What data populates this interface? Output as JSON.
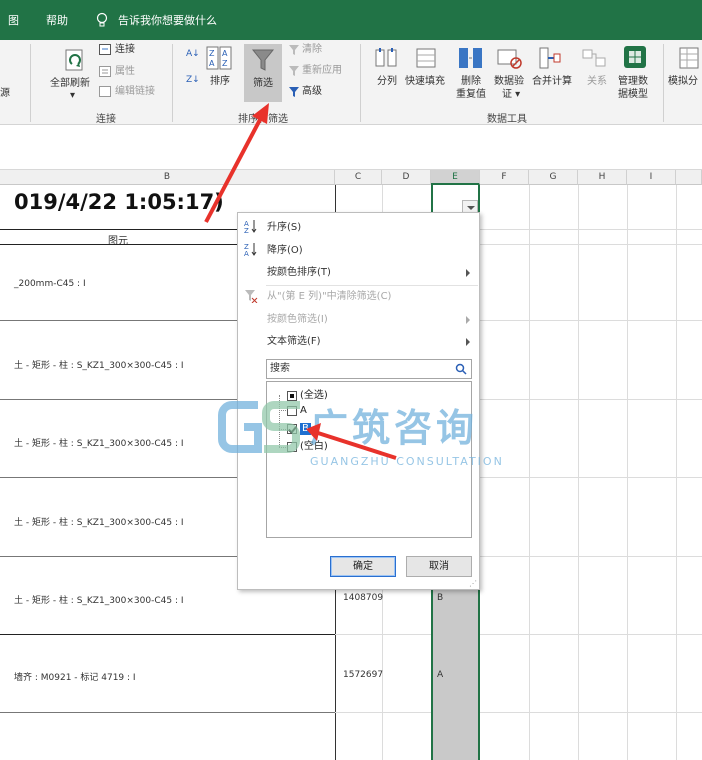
{
  "menubar": {
    "partial_tab": "图",
    "help_tab": "帮助",
    "tell_me": "告诉我你想要做什么",
    "bg_color": "#217346"
  },
  "ribbon": {
    "partial_source": "源",
    "refresh_all": "全部刷新",
    "connections": "连接",
    "properties": "属性",
    "edit_links": "编辑链接",
    "group_connections": "连接",
    "sort": "排序",
    "filter": "筛选",
    "clear": "清除",
    "reapply": "重新应用",
    "advanced": "高级",
    "group_sort_filter": "排序和筛选",
    "text_to_columns": "分列",
    "flash_fill": "快速填充",
    "remove_duplicates_1": "删除",
    "remove_duplicates_2": "重复值",
    "data_validation_1": "数据验",
    "data_validation_2": "证 ▾",
    "consolidate": "合并计算",
    "relationships": "关系",
    "manage_model_1": "管理数",
    "manage_model_2": "据模型",
    "group_data_tools": "数据工具",
    "partial_whatif": "模拟分"
  },
  "columns": [
    "B",
    "C",
    "D",
    "E",
    "F",
    "G",
    "H",
    "I"
  ],
  "sheet": {
    "date_text": "019/4/22 1:05:17)",
    "header_label": "图元",
    "rows": [
      {
        "b": "_200mm-C45 : I",
        "c": "",
        "e": ""
      },
      {
        "b": "土 - 矩形 - 柱 : S_KZ1_300×300-C45 : I",
        "c": "",
        "e": ""
      },
      {
        "b": "土 - 矩形 - 柱 : S_KZ1_300×300-C45 : I",
        "c": "",
        "e": ""
      },
      {
        "b": "土 - 矩形 - 柱 : S_KZ1_300×300-C45 : I",
        "c": "",
        "e": ""
      },
      {
        "b": "土 - 矩形 - 柱 : S_KZ1_300×300-C45 : I",
        "c": "1408709",
        "e": "B"
      },
      {
        "b": "墙齐 : M0921 - 标记 4719 : I",
        "c": "1572697",
        "e": "A"
      }
    ]
  },
  "filter_menu": {
    "sort_asc": "升序(S)",
    "sort_desc": "降序(O)",
    "sort_by_color": "按颜色排序(T)",
    "clear_filter": "从\"(第 E 列)\"中清除筛选(C)",
    "filter_by_color": "按颜色筛选(I)",
    "text_filter": "文本筛选(F)",
    "search_placeholder": "搜索",
    "items": [
      {
        "label": "(全选)",
        "state": "partial"
      },
      {
        "label": "A",
        "state": "unchecked"
      },
      {
        "label": "B",
        "state": "checked"
      },
      {
        "label": "(空白)",
        "state": "unchecked"
      }
    ],
    "ok": "确定",
    "cancel": "取消"
  },
  "watermark": {
    "cn": "广筑咨询",
    "en": "GUANGZHU CONSULTATION",
    "color": "#6fb0dc"
  },
  "annotation_color": "#e8322b"
}
